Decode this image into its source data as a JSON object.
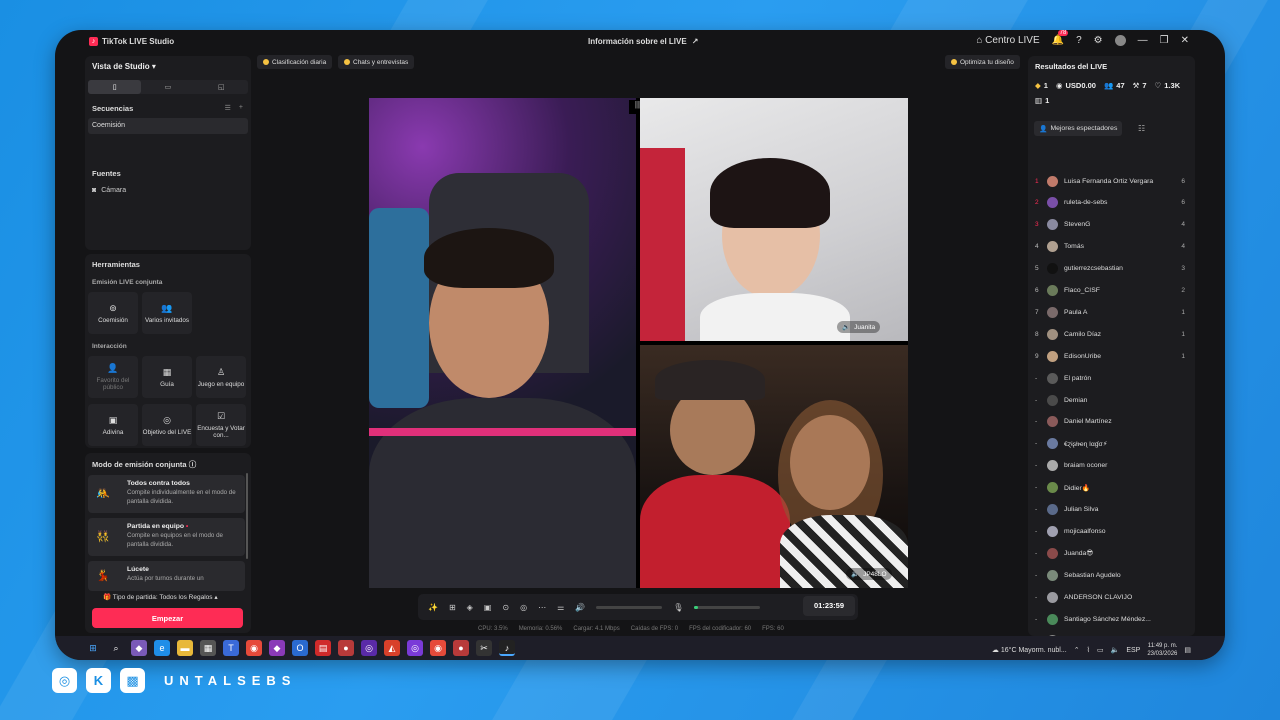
{
  "app": {
    "title": "TikTok LIVE Studio",
    "center_title": "Información sobre el LIVE",
    "centro_live": "Centro LIVE",
    "notif_count": "78"
  },
  "left": {
    "studio_view": "Vista de Studio",
    "sequences_label": "Secuencias",
    "sequence_item": "Coemisión",
    "sources_label": "Fuentes",
    "source_item": "Cámara",
    "tools_label": "Herramientas",
    "joint_label": "Emisión LIVE conjunta",
    "interaction_label": "Interacción",
    "tools": [
      {
        "label": "Coemisión"
      },
      {
        "label": "Varios invitados"
      },
      {
        "label": "Favorito del público"
      },
      {
        "label": "Guía"
      },
      {
        "label": "Juego en equipo"
      },
      {
        "label": "Adivina"
      },
      {
        "label": "Objetivo del LIVE"
      },
      {
        "label": "Encuesta y Votar con..."
      }
    ],
    "mode_title": "Modo de emisión conjunta",
    "modes": [
      {
        "title": "Todos contra todos",
        "desc": "Compite individualmente en el modo de pantalla dividida."
      },
      {
        "title": "Partida en equipo",
        "desc": "Compite en equipos en el modo de pantalla dividida."
      },
      {
        "title": "Lúcete",
        "desc": "Actúa por turnos durante un"
      }
    ],
    "party_type": "Tipo de partida: Todos los Regalos",
    "start_button": "Empezar"
  },
  "chips": {
    "daily": "Clasificación diaria",
    "chats": "Chats y entrevistas",
    "optimize": "Optimiza tu diseño"
  },
  "video": {
    "tr_name": "Juanita",
    "br_name": "JP48LO",
    "mini": "|||"
  },
  "controls": {
    "timer": "01:23:59",
    "volume_level": 0.0,
    "mic_level": 0.05
  },
  "stats": {
    "cpu": "CPU:  3.5%",
    "mem": "Memoria:  0.56%",
    "load": "Cargar:  4.1 Mbps",
    "drops": "Caídas de FPS:  0",
    "encoder": "FPS del codificador:  60",
    "fps": "FPS:  60"
  },
  "right": {
    "title": "Resultados del LIVE",
    "s1": "1",
    "s2": "USD0.00",
    "s3": "47",
    "s4": "7",
    "s5": "1.3K",
    "s6": "1",
    "top_viewers": "Mejores espectadores",
    "viewers": [
      {
        "rank": "1",
        "name": "Luisa Fernanda Ortiz Vergara",
        "score": "6",
        "color": "#c07a6a"
      },
      {
        "rank": "2",
        "name": "ruleta-de-sebs",
        "score": "6",
        "color": "#7a4fa8"
      },
      {
        "rank": "3",
        "name": "StevenG",
        "score": "4",
        "color": "#8a8aa0"
      },
      {
        "rank": "4",
        "name": "Tomás",
        "score": "4",
        "color": "#b0a090"
      },
      {
        "rank": "5",
        "name": "gutierrezcsebastian",
        "score": "3",
        "color": "#111111"
      },
      {
        "rank": "6",
        "name": "Flaco_CISF",
        "score": "2",
        "color": "#6a7a5a"
      },
      {
        "rank": "7",
        "name": "Paula A",
        "score": "1",
        "color": "#7a6a6a"
      },
      {
        "rank": "8",
        "name": "Camilo Díaz",
        "score": "1",
        "color": "#a09080"
      },
      {
        "rank": "9",
        "name": "EdisonUribe",
        "score": "1",
        "color": "#c0a080"
      },
      {
        "rank": "-",
        "name": "El patrón",
        "score": "",
        "color": "#5a5a5a"
      },
      {
        "rank": "-",
        "name": "Demian",
        "score": "",
        "color": "#4a4a4a"
      },
      {
        "rank": "-",
        "name": "Daniel Martínez",
        "score": "",
        "color": "#8a5a5a"
      },
      {
        "rank": "-",
        "name": "€ɀɨʂƚιҽɳ Ɩαɠσ⚡",
        "score": "",
        "color": "#6a7aa0"
      },
      {
        "rank": "-",
        "name": "braiam oconer",
        "score": "",
        "color": "#aaaaaa"
      },
      {
        "rank": "-",
        "name": "Didier🔥",
        "score": "",
        "color": "#6a8a4a"
      },
      {
        "rank": "-",
        "name": "Julian Silva",
        "score": "",
        "color": "#5a6a8a"
      },
      {
        "rank": "-",
        "name": "mojicaalfonso",
        "score": "",
        "color": "#a0a0b0"
      },
      {
        "rank": "-",
        "name": "Juanda😎",
        "score": "",
        "color": "#8a4a4a"
      },
      {
        "rank": "-",
        "name": "Sebastian Agudelo",
        "score": "",
        "color": "#7a8a7a"
      },
      {
        "rank": "-",
        "name": "ANDERSON CLAVIJO",
        "score": "",
        "color": "#9a9aa0"
      },
      {
        "rank": "-",
        "name": "Santiago Sánchez Méndez...",
        "score": "",
        "color": "#4a8a5a"
      },
      {
        "rank": "-",
        "name": "RobRocha18",
        "score": "",
        "color": "#8a8a8a"
      }
    ]
  },
  "taskbar": {
    "weather": "16°C  Mayorm. nubl...",
    "lang": "ESP",
    "time": "11:49 p. m.",
    "date": "23/03/2026"
  },
  "brand": {
    "handle": "UNTALSEBS"
  }
}
